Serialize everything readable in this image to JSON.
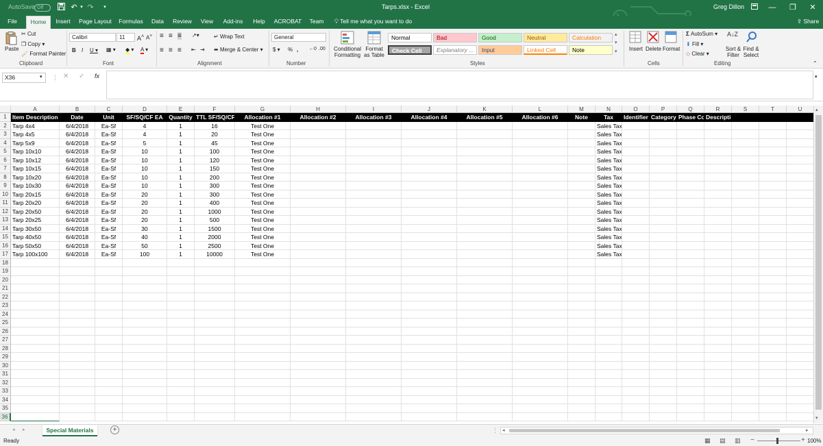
{
  "titlebar": {
    "autosave_label": "AutoSave",
    "autosave_state": "Off",
    "title": "Tarps.xlsx  -  Excel",
    "user": "Greg Dillon"
  },
  "tabs": [
    "File",
    "Home",
    "Insert",
    "Page Layout",
    "Formulas",
    "Data",
    "Review",
    "View",
    "Add-ins",
    "Help",
    "ACROBAT",
    "Team"
  ],
  "active_tab": "Home",
  "tellme": "Tell me what you want to do",
  "share": "Share",
  "ribbon": {
    "clipboard": {
      "paste": "Paste",
      "cut": "Cut",
      "copy": "Copy",
      "format_painter": "Format Painter",
      "label": "Clipboard"
    },
    "font": {
      "name": "Calibri",
      "size": "11",
      "label": "Font"
    },
    "alignment": {
      "wrap": "Wrap Text",
      "merge": "Merge & Center",
      "label": "Alignment"
    },
    "number": {
      "format": "General",
      "label": "Number"
    },
    "styles": {
      "conditional": "Conditional Formatting",
      "format_table": "Format as Table",
      "cells": [
        {
          "text": "Normal",
          "bg": "#ffffff",
          "fg": "#000000"
        },
        {
          "text": "Bad",
          "bg": "#ffc7ce",
          "fg": "#9c0006"
        },
        {
          "text": "Good",
          "bg": "#c6efce",
          "fg": "#006100"
        },
        {
          "text": "Neutral",
          "bg": "#ffeb9c",
          "fg": "#9c5700"
        },
        {
          "text": "Calculation",
          "bg": "#f2f2f2",
          "fg": "#fa7d00"
        },
        {
          "text": "Check Cell",
          "bg": "#a5a5a5",
          "fg": "#ffffff"
        },
        {
          "text": "Explanatory ...",
          "bg": "#ffffff",
          "fg": "#7f7f7f"
        },
        {
          "text": "Input",
          "bg": "#ffcc99",
          "fg": "#3f3f76"
        },
        {
          "text": "Linked Cell",
          "bg": "#ffffff",
          "fg": "#fa7d00"
        },
        {
          "text": "Note",
          "bg": "#ffffcc",
          "fg": "#000000"
        }
      ],
      "label": "Styles"
    },
    "cells": {
      "insert": "Insert",
      "delete": "Delete",
      "format": "Format",
      "label": "Cells"
    },
    "editing": {
      "autosum": "AutoSum",
      "fill": "Fill",
      "clear": "Clear",
      "sort": "Sort & Filter",
      "find": "Find & Select",
      "label": "Editing"
    }
  },
  "formula_bar": {
    "name_box": "X36",
    "formula": ""
  },
  "columns": [
    "A",
    "B",
    "C",
    "D",
    "E",
    "F",
    "G",
    "H",
    "I",
    "J",
    "K",
    "L",
    "M",
    "N",
    "O",
    "P",
    "Q",
    "R",
    "S",
    "T",
    "U"
  ],
  "header_row": [
    "Item Description",
    "Date",
    "Unit",
    "SF/SQ/CF EA",
    "Quantity",
    "TTL SF/SQ/CF",
    "Allocation #1",
    "Allocation #2",
    "Allocation #3",
    "Allocation #4",
    "Allocation #5",
    "Allocation #6",
    "Note",
    "Tax",
    "Identifier",
    "Category",
    "Phase Cod",
    "Description",
    "",
    "",
    ""
  ],
  "rows": [
    [
      "Tarp 4x4",
      "6/4/2018",
      "Ea-Sf",
      "4",
      "1",
      "16",
      "Test One",
      "Sales Tax"
    ],
    [
      "Tarp 4x5",
      "6/4/2018",
      "Ea-Sf",
      "4",
      "1",
      "20",
      "Test One",
      "Sales Tax"
    ],
    [
      "Tarp 5x9",
      "6/4/2018",
      "Ea-Sf",
      "5",
      "1",
      "45",
      "Test One",
      "Sales Tax"
    ],
    [
      "Tarp 10x10",
      "6/4/2018",
      "Ea-Sf",
      "10",
      "1",
      "100",
      "Test One",
      "Sales Tax"
    ],
    [
      "Tarp 10x12",
      "6/4/2018",
      "Ea-Sf",
      "10",
      "1",
      "120",
      "Test One",
      "Sales Tax"
    ],
    [
      "Tarp 10x15",
      "6/4/2018",
      "Ea-Sf",
      "10",
      "1",
      "150",
      "Test One",
      "Sales Tax"
    ],
    [
      "Tarp 10x20",
      "6/4/2018",
      "Ea-Sf",
      "10",
      "1",
      "200",
      "Test One",
      "Sales Tax"
    ],
    [
      "Tarp 10x30",
      "6/4/2018",
      "Ea-Sf",
      "10",
      "1",
      "300",
      "Test One",
      "Sales Tax"
    ],
    [
      "Tarp 20x15",
      "6/4/2018",
      "Ea-Sf",
      "20",
      "1",
      "300",
      "Test One",
      "Sales Tax"
    ],
    [
      "Tarp 20x20",
      "6/4/2018",
      "Ea-Sf",
      "20",
      "1",
      "400",
      "Test One",
      "Sales Tax"
    ],
    [
      "Tarp 20x50",
      "6/4/2018",
      "Ea-Sf",
      "20",
      "1",
      "1000",
      "Test One",
      "Sales Tax"
    ],
    [
      "Tarp 20x25",
      "6/4/2018",
      "Ea-Sf",
      "20",
      "1",
      "500",
      "Test One",
      "Sales Tax"
    ],
    [
      "Tarp 30x50",
      "6/4/2018",
      "Ea-Sf",
      "30",
      "1",
      "1500",
      "Test One",
      "Sales Tax"
    ],
    [
      "Tarp 40x50",
      "6/4/2018",
      "Ea-Sf",
      "40",
      "1",
      "2000",
      "Test One",
      "Sales Tax"
    ],
    [
      "Tarp 50x50",
      "6/4/2018",
      "Ea-Sf",
      "50",
      "1",
      "2500",
      "Test One",
      "Sales Tax"
    ],
    [
      "Tarp 100x100",
      "6/4/2018",
      "Ea-Sf",
      "100",
      "1",
      "10000",
      "Test One",
      "Sales Tax"
    ]
  ],
  "row_numbers": [
    "1",
    "2",
    "3",
    "4",
    "5",
    "6",
    "7",
    "8",
    "9",
    "10",
    "11",
    "12",
    "13",
    "14",
    "15",
    "16",
    "17",
    "18",
    "19",
    "20",
    "21",
    "22",
    "23",
    "24",
    "25",
    "26",
    "27",
    "28",
    "29",
    "30",
    "31",
    "32",
    "33",
    "34",
    "35",
    "36"
  ],
  "selected_row": "36",
  "sheet_tab": "Special Materials",
  "status": {
    "ready": "Ready",
    "zoom": "100%"
  },
  "colors": {
    "accent": "#217346",
    "header_bg": "#000000"
  }
}
